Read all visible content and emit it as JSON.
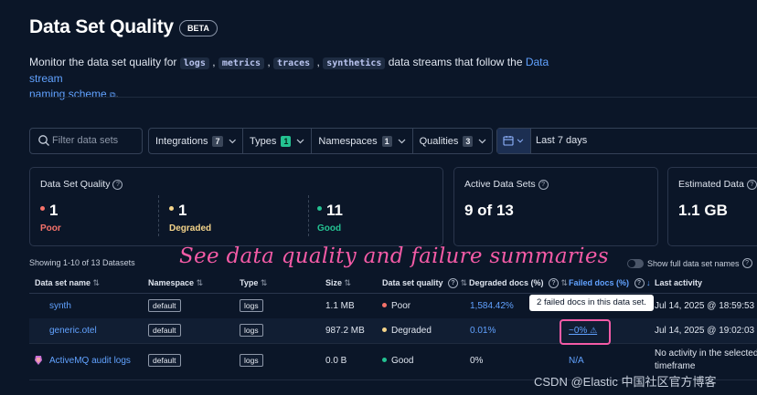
{
  "page": {
    "title": "Data Set Quality",
    "badge": "BETA",
    "desc_prefix": "Monitor the data set quality for",
    "streams": [
      "logs",
      "metrics",
      "traces",
      "synthetics"
    ],
    "desc_mid": "data streams that follow the",
    "desc_link_1": "Data stream",
    "desc_link_2": "naming scheme",
    "desc_end": "."
  },
  "filters": {
    "search_placeholder": "Filter data sets",
    "integrations": {
      "label": "Integrations",
      "count": "7"
    },
    "types": {
      "label": "Types",
      "count": "1"
    },
    "namespaces": {
      "label": "Namespaces",
      "count": "1"
    },
    "qualities": {
      "label": "Qualities",
      "count": "3"
    },
    "date_range": "Last 7 days"
  },
  "summary": {
    "quality_title": "Data Set Quality",
    "poor": {
      "value": "1",
      "label": "Poor",
      "color": "#f6726a"
    },
    "degraded": {
      "value": "1",
      "label": "Degraded",
      "color": "#f4d48a"
    },
    "good": {
      "value": "11",
      "label": "Good",
      "color": "#24c292"
    },
    "active_title": "Active Data Sets",
    "active_value": "9 of 13",
    "estimated_title": "Estimated Data",
    "estimated_value": "1.1 GB"
  },
  "table": {
    "showing": "Showing 1-10 of 13 Datasets",
    "show_full_names": "Show full data set names",
    "headers": {
      "name": "Data set name",
      "namespace": "Namespace",
      "type": "Type",
      "size": "Size",
      "quality": "Data set quality",
      "degraded": "Degraded docs (%)",
      "failed": "Failed docs (%)",
      "last_activity": "Last activity"
    },
    "rows": [
      {
        "name": "synth",
        "namespace": "default",
        "type": "logs",
        "size": "1.1 MB",
        "quality": "Poor",
        "quality_color": "#f6726a",
        "degraded": "1,584.42%",
        "failed": "",
        "last_activity": "Jul 14, 2025 @ 18:59:53"
      },
      {
        "name": "generic.otel",
        "namespace": "default",
        "type": "logs",
        "size": "987.2 MB",
        "quality": "Degraded",
        "quality_color": "#f4d48a",
        "degraded": "0.01%",
        "failed": "~0%",
        "last_activity": "Jul 14, 2025 @ 19:02:03"
      },
      {
        "name": "ActiveMQ audit logs",
        "namespace": "default",
        "type": "logs",
        "size": "0.0 B",
        "quality": "Good",
        "quality_color": "#24c292",
        "degraded": "0%",
        "failed": "N/A",
        "last_activity": "No activity in the selected",
        "last_activity_2": "timeframe"
      }
    ]
  },
  "tooltip": "2 failed docs in this data set.",
  "overlay_caption": "See data quality and failure summaries",
  "watermark": "CSDN @Elastic 中国社区官方博客"
}
